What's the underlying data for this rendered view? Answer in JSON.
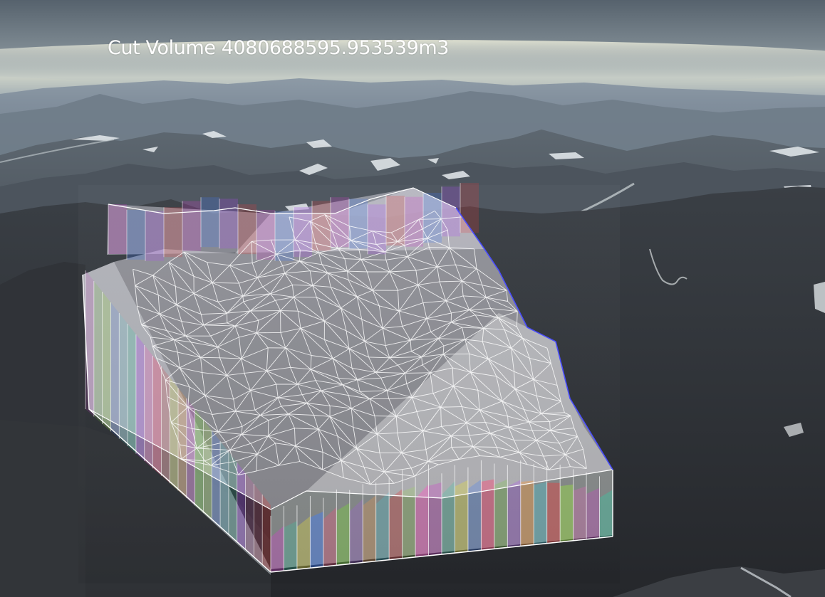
{
  "measurement": {
    "label": "Cut Volume",
    "value": "4080688595.953539",
    "unit": "m3"
  },
  "colors": {
    "sky_top": "#5b6772",
    "sky_haze": "#cfd7d6",
    "mountain_near": "#2a2c30",
    "snow": "#e8ecee",
    "mesh_line": "#ffffff",
    "label_text": "#ffffff"
  },
  "icons": []
}
